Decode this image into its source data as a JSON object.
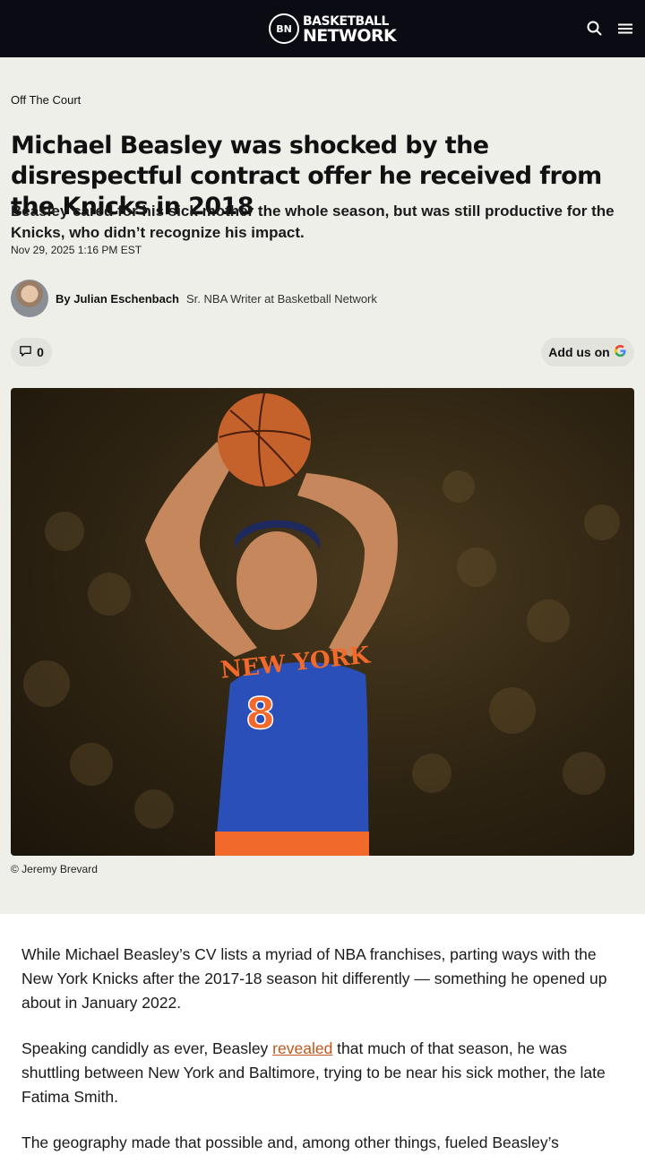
{
  "brand": {
    "logo_badge": "BN",
    "name_line1": "BASKETBALL",
    "name_line2": "NETWORK"
  },
  "header": {
    "search_icon": "search-icon",
    "menu_icon": "hamburger-menu-icon"
  },
  "article": {
    "category": "Off The Court",
    "headline": "Michael Beasley was shocked by the disrespectful contract offer he received from the Knicks in 2018",
    "dek": "Beasley cared for his sick mother the whole season, but was still productive for the Knicks, who didn’t recognize his impact.",
    "date": "Nov 29, 2025 1:16 PM EST",
    "author_by": "By Julian Eschenbach",
    "author_role": "Sr. NBA Writer at Basketball Network",
    "comment_count": "0",
    "add_us_label": "Add us on",
    "photo_credit": "© Jeremy Brevard",
    "jersey_text": "NEW YORK",
    "jersey_number": "8",
    "p1": "While Michael Beasley’s CV lists a myriad of NBA franchises, parting ways with the New York Knicks after the 2017-18 season hit differently — something he opened up about in January 2022.",
    "p2_before": "Speaking candidly as ever, Beasley ",
    "p2_link": "revealed",
    "p2_after": " that much of that season, he was shuttling between New York and Baltimore, trying to be near his sick mother, the late Fatima Smith.",
    "p3": "The geography made that possible and, among other things, fueled Beasley’s"
  },
  "colors": {
    "topbar": "#0b0b13",
    "hero_bg": "#efefea",
    "link": "#c0571a",
    "knicks_blue": "#2a4fb8",
    "knicks_orange": "#f26a2b"
  }
}
